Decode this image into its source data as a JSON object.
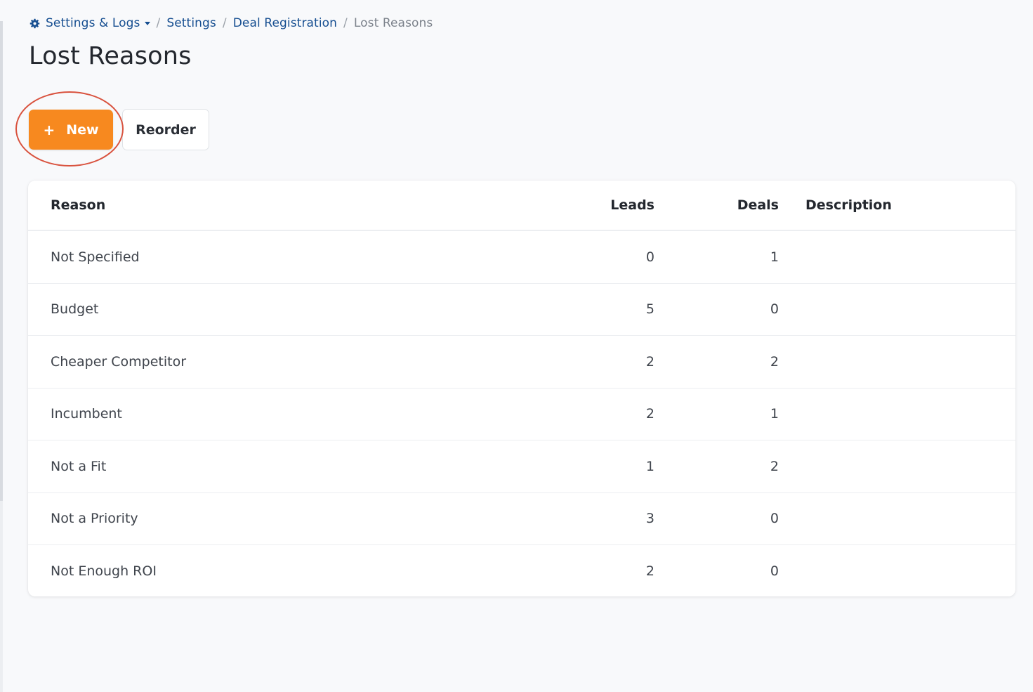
{
  "breadcrumb": {
    "root": "Settings & Logs",
    "settings": "Settings",
    "deal_registration": "Deal Registration",
    "current": "Lost Reasons",
    "separator": "/"
  },
  "page": {
    "title": "Lost Reasons"
  },
  "toolbar": {
    "new_label": "New",
    "new_icon": "plus-icon",
    "reorder_label": "Reorder",
    "accent_color": "#f7891f",
    "highlight_color": "#d9533f"
  },
  "table": {
    "headers": {
      "reason": "Reason",
      "leads": "Leads",
      "deals": "Deals",
      "description": "Description"
    },
    "rows": [
      {
        "reason": "Not Specified",
        "leads": "0",
        "deals": "1",
        "description": ""
      },
      {
        "reason": "Budget",
        "leads": "5",
        "deals": "0",
        "description": ""
      },
      {
        "reason": "Cheaper Competitor",
        "leads": "2",
        "deals": "2",
        "description": ""
      },
      {
        "reason": "Incumbent",
        "leads": "2",
        "deals": "1",
        "description": ""
      },
      {
        "reason": "Not a Fit",
        "leads": "1",
        "deals": "2",
        "description": ""
      },
      {
        "reason": "Not a Priority",
        "leads": "3",
        "deals": "0",
        "description": ""
      },
      {
        "reason": "Not Enough ROI",
        "leads": "2",
        "deals": "0",
        "description": ""
      }
    ]
  }
}
